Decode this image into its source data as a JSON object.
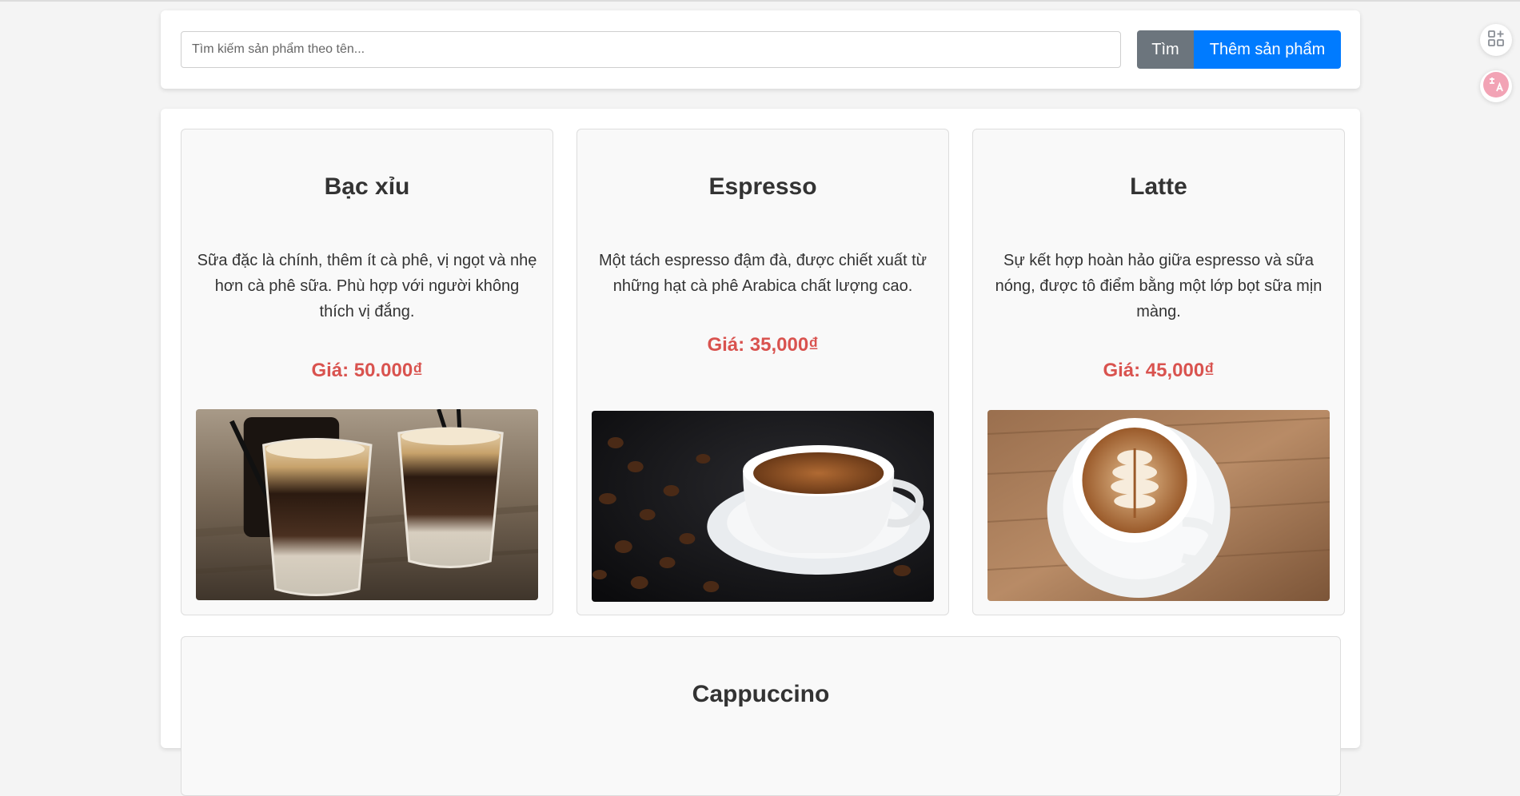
{
  "search": {
    "placeholder": "Tìm kiếm sản phẩm theo tên...",
    "value": "",
    "search_label": "Tìm",
    "add_label": "Thêm sản phẩm"
  },
  "products": [
    {
      "name": "Bạc xỉu",
      "description": "Sữa đặc là chính, thêm ít cà phê, vị ngọt và nhẹ hơn cà phê sữa. Phù hợp với người không thích vị đắng.",
      "price": "Giá: 50.000₫",
      "image": "iced-milk-coffee-glasses"
    },
    {
      "name": "Espresso",
      "description": "Một tách espresso đậm đà, được chiết xuất từ những hạt cà phê Arabica chất lượng cao.",
      "price": "Giá: 35,000₫",
      "image": "espresso-cup-coffee-beans"
    },
    {
      "name": "Latte",
      "description": "Sự kết hợp hoàn hảo giữa espresso và sữa nóng, được tô điểm bằng một lớp bọt sữa mịn màng.",
      "price": "Giá: 45,000₫",
      "image": "latte-art-cup-wood-table"
    },
    {
      "name": "Cappuccino"
    }
  ],
  "side_tools": {
    "icons": [
      "grid-plus-icon",
      "translate-icon"
    ]
  },
  "colors": {
    "price": "#d9534f",
    "search_button": "#6c757d",
    "add_button": "#007bff",
    "translate_badge": "#f2a3b5"
  }
}
